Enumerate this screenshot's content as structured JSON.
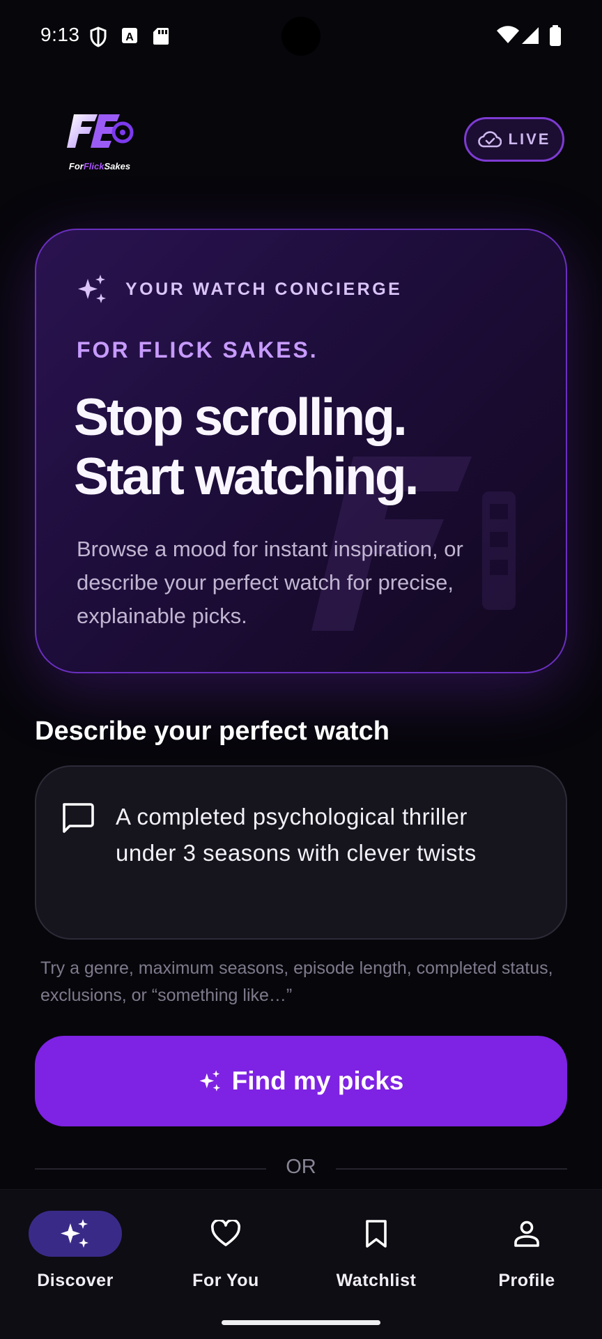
{
  "status_bar": {
    "time": "9:13",
    "left_icons": [
      "shield-icon",
      "a-badge-icon",
      "sd-card-icon"
    ],
    "right_icons": [
      "wifi-icon",
      "signal-icon",
      "battery-icon"
    ]
  },
  "header": {
    "logo": {
      "brand_prefix": "For",
      "brand_accent": "Flick",
      "brand_suffix": "Sakes"
    },
    "live_badge": {
      "label": "LIVE",
      "icon": "cloud-check-icon"
    }
  },
  "hero": {
    "eyebrow": "YOUR WATCH CONCIERGE",
    "eyebrow_icon": "sparkles-icon",
    "tagline": "FOR FLICK SAKES.",
    "headline_line1": "Stop scrolling.",
    "headline_line2": "Start watching.",
    "body": "Browse a mood for instant inspiration, or describe your perfect watch for precise, explainable picks."
  },
  "describe": {
    "title": "Describe your perfect watch",
    "input_icon": "chat-bubble-icon",
    "input_value": "A completed psychological thriller under 3 seasons with clever twists",
    "hint": "Try a genre, maximum seasons, episode length, completed status, exclusions, or “something like…”"
  },
  "cta": {
    "label": "Find my picks",
    "icon": "sparkles-icon"
  },
  "divider": {
    "label": "OR"
  },
  "bottom_nav": {
    "items": [
      {
        "label": "Discover",
        "icon": "sparkles-icon",
        "active": true
      },
      {
        "label": "For You",
        "icon": "heart-icon",
        "active": false
      },
      {
        "label": "Watchlist",
        "icon": "bookmark-icon",
        "active": false
      },
      {
        "label": "Profile",
        "icon": "person-icon",
        "active": false
      }
    ]
  },
  "colors": {
    "background": "#07060b",
    "accent": "#7e22e3",
    "accent_light": "#c79bff",
    "nav_active": "#3a2a88"
  }
}
